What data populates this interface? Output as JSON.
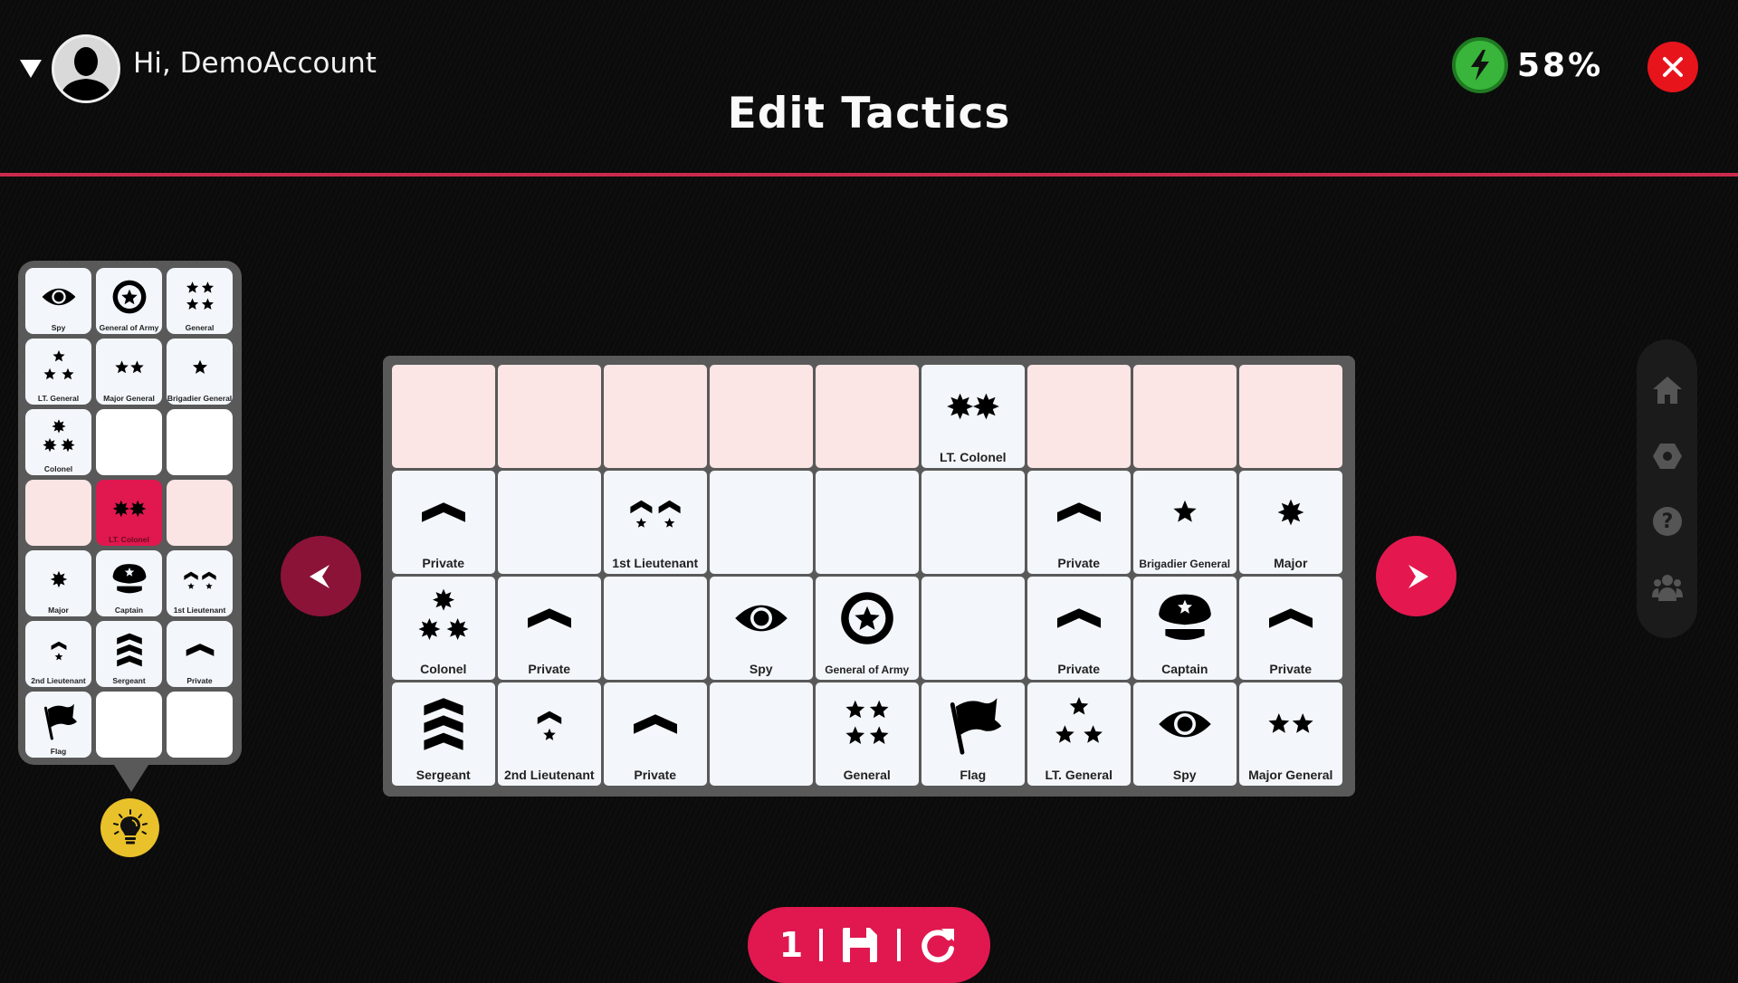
{
  "header": {
    "greeting": "Hi, DemoAccount",
    "energy_percent": "58%",
    "title": "Edit Tactics"
  },
  "colors": {
    "accent": "#e0184f",
    "header_line": "#cc2a4d",
    "energy": "#38b53a",
    "close": "#e8141c",
    "hint": "#e9c12a",
    "panel": "#595959",
    "cell": "#f3f7fb",
    "cell_pink": "#fce5e5"
  },
  "palette": {
    "cells": [
      {
        "piece": "spy",
        "label": "Spy",
        "state": "filled"
      },
      {
        "piece": "general-of-army",
        "label": "General of Army",
        "state": "filled"
      },
      {
        "piece": "general",
        "label": "General",
        "state": "filled"
      },
      {
        "piece": "lt-general",
        "label": "LT. General",
        "state": "filled"
      },
      {
        "piece": "major-general",
        "label": "Major General",
        "state": "filled"
      },
      {
        "piece": "brigadier-general",
        "label": "Brigadier General",
        "state": "filled"
      },
      {
        "piece": "colonel",
        "label": "Colonel",
        "state": "filled"
      },
      {
        "piece": "",
        "label": "",
        "state": "empty"
      },
      {
        "piece": "",
        "label": "",
        "state": "empty"
      },
      {
        "piece": "",
        "label": "",
        "state": "pink"
      },
      {
        "piece": "lt-colonel",
        "label": "LT. Colonel",
        "state": "selected"
      },
      {
        "piece": "",
        "label": "",
        "state": "pink"
      },
      {
        "piece": "major",
        "label": "Major",
        "state": "filled"
      },
      {
        "piece": "captain",
        "label": "Captain",
        "state": "filled"
      },
      {
        "piece": "1st-lieutenant",
        "label": "1st Lieutenant",
        "state": "filled"
      },
      {
        "piece": "2nd-lieutenant",
        "label": "2nd Lieutenant",
        "state": "filled"
      },
      {
        "piece": "sergeant",
        "label": "Sergeant",
        "state": "filled"
      },
      {
        "piece": "private",
        "label": "Private",
        "state": "filled"
      },
      {
        "piece": "flag",
        "label": "Flag",
        "state": "filled"
      },
      {
        "piece": "",
        "label": "",
        "state": "empty"
      },
      {
        "piece": "",
        "label": "",
        "state": "empty"
      }
    ]
  },
  "board": {
    "rows": [
      [
        {
          "piece": "",
          "label": "",
          "state": "pink"
        },
        {
          "piece": "",
          "label": "",
          "state": "pink"
        },
        {
          "piece": "",
          "label": "",
          "state": "pink"
        },
        {
          "piece": "",
          "label": "",
          "state": "pink"
        },
        {
          "piece": "",
          "label": "",
          "state": "pink"
        },
        {
          "piece": "lt-colonel",
          "label": "LT. Colonel",
          "state": "filled"
        },
        {
          "piece": "",
          "label": "",
          "state": "pink"
        },
        {
          "piece": "",
          "label": "",
          "state": "pink"
        },
        {
          "piece": "",
          "label": "",
          "state": "pink"
        }
      ],
      [
        {
          "piece": "private",
          "label": "Private",
          "state": "filled"
        },
        {
          "piece": "",
          "label": "",
          "state": "empty"
        },
        {
          "piece": "1st-lieutenant",
          "label": "1st Lieutenant",
          "state": "filled"
        },
        {
          "piece": "",
          "label": "",
          "state": "empty"
        },
        {
          "piece": "",
          "label": "",
          "state": "empty"
        },
        {
          "piece": "",
          "label": "",
          "state": "empty"
        },
        {
          "piece": "private",
          "label": "Private",
          "state": "filled"
        },
        {
          "piece": "brigadier-general",
          "label": "Brigadier General",
          "state": "filled"
        },
        {
          "piece": "major",
          "label": "Major",
          "state": "filled"
        }
      ],
      [
        {
          "piece": "colonel",
          "label": "Colonel",
          "state": "filled"
        },
        {
          "piece": "private",
          "label": "Private",
          "state": "filled"
        },
        {
          "piece": "",
          "label": "",
          "state": "empty"
        },
        {
          "piece": "spy",
          "label": "Spy",
          "state": "filled"
        },
        {
          "piece": "general-of-army",
          "label": "General of Army",
          "state": "filled"
        },
        {
          "piece": "",
          "label": "",
          "state": "empty"
        },
        {
          "piece": "private",
          "label": "Private",
          "state": "filled"
        },
        {
          "piece": "captain",
          "label": "Captain",
          "state": "filled"
        },
        {
          "piece": "private",
          "label": "Private",
          "state": "filled"
        }
      ],
      [
        {
          "piece": "sergeant",
          "label": "Sergeant",
          "state": "filled"
        },
        {
          "piece": "2nd-lieutenant",
          "label": "2nd Lieutenant",
          "state": "filled"
        },
        {
          "piece": "private",
          "label": "Private",
          "state": "filled"
        },
        {
          "piece": "",
          "label": "",
          "state": "empty"
        },
        {
          "piece": "general",
          "label": "General",
          "state": "filled"
        },
        {
          "piece": "flag",
          "label": "Flag",
          "state": "filled"
        },
        {
          "piece": "lt-general",
          "label": "LT. General",
          "state": "filled"
        },
        {
          "piece": "spy",
          "label": "Spy",
          "state": "filled"
        },
        {
          "piece": "major-general",
          "label": "Major General",
          "state": "filled"
        }
      ]
    ]
  },
  "nav": {
    "prev_icon": "chevron-left-icon",
    "next_icon": "chevron-right-icon",
    "side_items": [
      {
        "name": "home",
        "icon": "home-icon"
      },
      {
        "name": "settings",
        "icon": "settings-icon"
      },
      {
        "name": "help",
        "icon": "help-icon"
      },
      {
        "name": "community",
        "icon": "users-icon"
      }
    ]
  },
  "bottom_bar": {
    "page_number": "1",
    "save_icon": "save-icon",
    "reset_icon": "reset-icon"
  }
}
